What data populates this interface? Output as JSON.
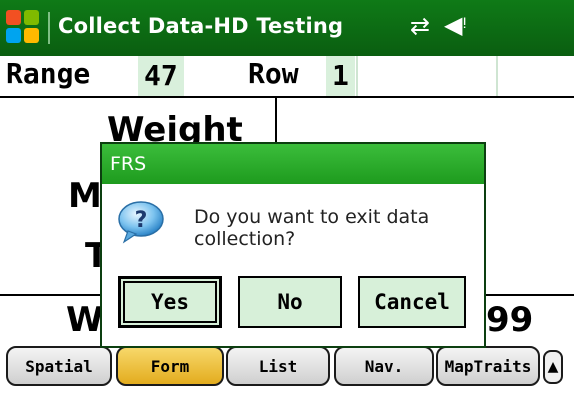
{
  "titlebar": {
    "app_title": "Collect Data-HD Testing",
    "icons": [
      "windows-start-icon",
      "connectivity-icon",
      "volume-icon"
    ]
  },
  "form": {
    "range_label": "Range",
    "range_value": "47",
    "row_label": "Row",
    "row_value": "1",
    "weight_label": "Weight",
    "partial_left_1": "M",
    "partial_left_2": "T",
    "partial_left_3": "W",
    "partial_right": "99"
  },
  "dialog": {
    "title": "FRS",
    "message": "Do you want to exit data collection?",
    "buttons": {
      "yes": "Yes",
      "no": "No",
      "cancel": "Cancel"
    }
  },
  "tabs": [
    {
      "label": "Spatial",
      "active": false
    },
    {
      "label": "Form",
      "active": true
    },
    {
      "label": "List",
      "active": false
    },
    {
      "label": "Nav.",
      "active": false
    },
    {
      "label": "MapTraits",
      "active": false
    }
  ],
  "tab_scroll": "▲",
  "colors": {
    "titlebar": "#0f7a17",
    "dialog_title": "#2aac2a",
    "highlight": "#d9f0dc",
    "active_tab": "#f0c23c"
  }
}
